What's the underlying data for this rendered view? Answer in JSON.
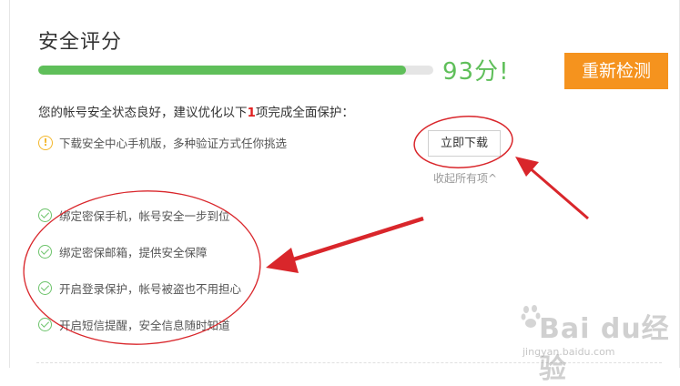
{
  "panel": {
    "title": "安全评分",
    "score_text": "93分!",
    "score_percent": 93,
    "rescan_label": "重新检测"
  },
  "status": {
    "prefix": "您的帐号安全状态良好，建议优化以下",
    "count": "1",
    "suffix": "项完成全面保护："
  },
  "suggestion": {
    "text": "下载安全中心手机版，多种验证方式任你挑选",
    "action_label": "立即下载",
    "icon": "warning-circle-icon"
  },
  "collapse_label": "收起所有项^",
  "completed_items": [
    {
      "text": "绑定密保手机，帐号安全一步到位",
      "icon": "check-circle-icon"
    },
    {
      "text": "绑定密保邮箱，提供安全保障",
      "icon": "check-circle-icon"
    },
    {
      "text": "开启登录保护，帐号被盗也不用担心",
      "icon": "check-circle-icon"
    },
    {
      "text": "开启短信提醒，安全信息随时知道",
      "icon": "check-circle-icon"
    }
  ],
  "watermark": {
    "brand": "Bai du经验",
    "url": "jingyan.baidu.com"
  },
  "colors": {
    "accent_green": "#5fbf5a",
    "button_orange": "#f5931e",
    "annotation_red": "#d9262b",
    "warning_yellow": "#f3b72c"
  }
}
